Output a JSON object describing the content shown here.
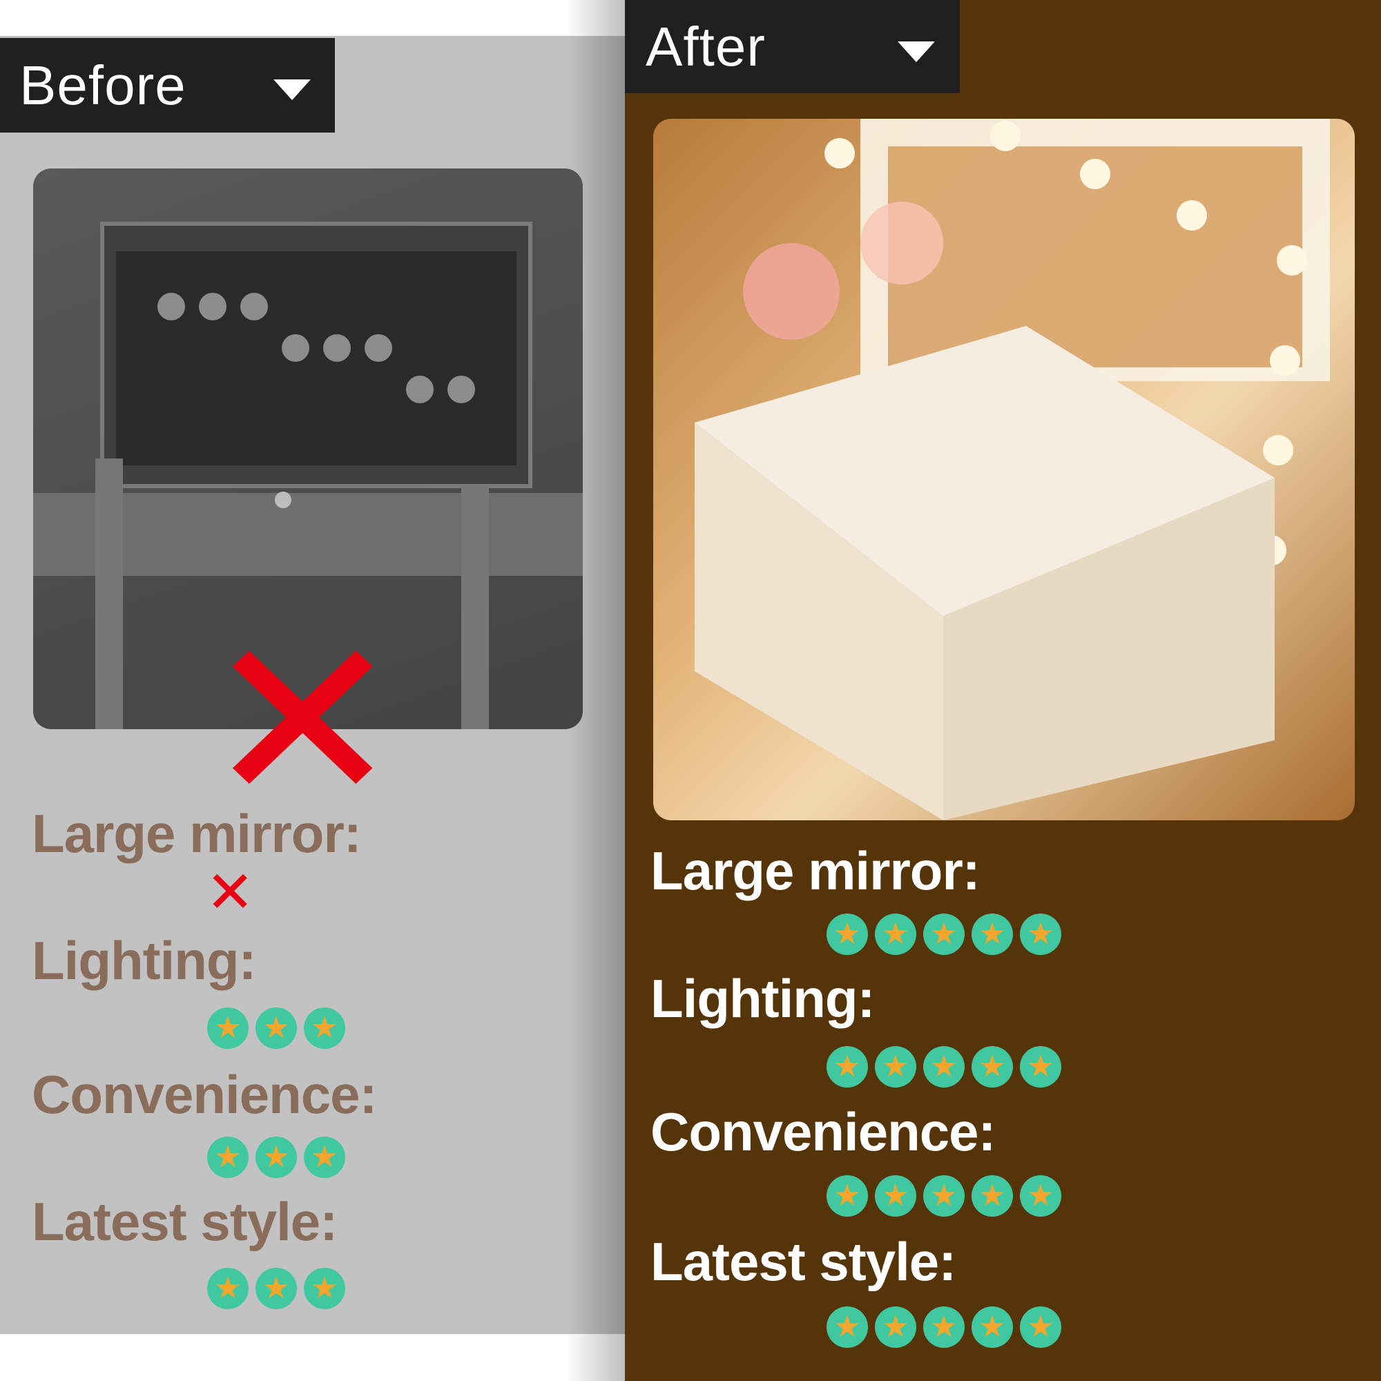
{
  "before": {
    "header": "Before",
    "ratings": [
      {
        "label": "Large mirror:",
        "value": 0
      },
      {
        "label": "Lighting:",
        "value": 3
      },
      {
        "label": "Convenience:",
        "value": 3
      },
      {
        "label": "Latest style:",
        "value": 3
      }
    ]
  },
  "after": {
    "header": "After",
    "ratings": [
      {
        "label": "Large mirror:",
        "value": 5
      },
      {
        "label": "Lighting:",
        "value": 5
      },
      {
        "label": "Convenience:",
        "value": 5
      },
      {
        "label": "Latest style:",
        "value": 5
      }
    ]
  },
  "icons": {
    "cross": "cross-mark-icon",
    "star": "star-icon",
    "dropdown": "chevron-down-icon"
  },
  "colors": {
    "cross": "#e60012",
    "star_bg": "#40c8a0",
    "star_fg": "#f4a52b",
    "before_label": "#8a6c5b",
    "after_bg": "#55340a"
  }
}
